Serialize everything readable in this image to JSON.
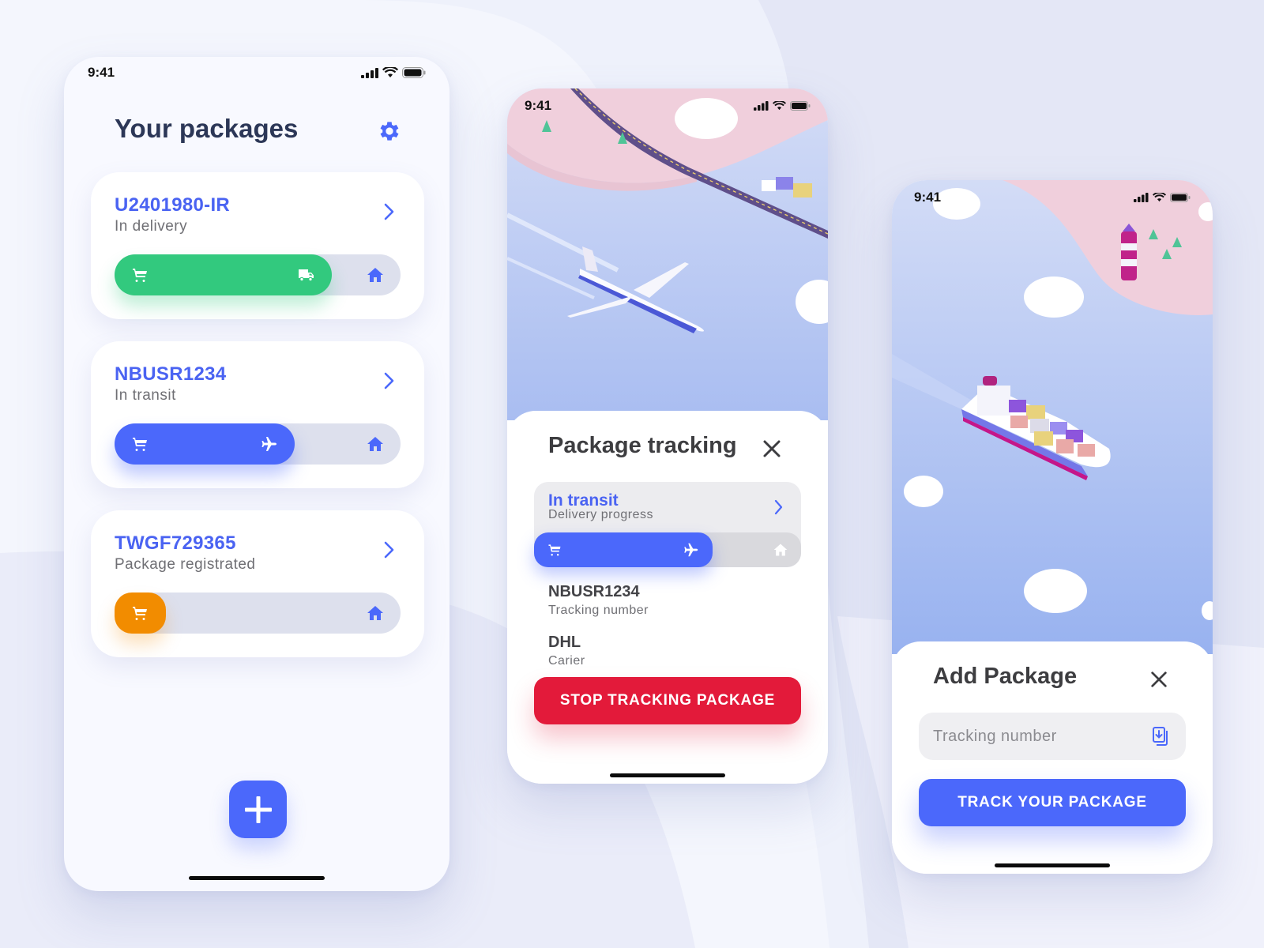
{
  "colors": {
    "accent": "#4b68fb",
    "green": "#32c97e",
    "orange": "#f28c00",
    "red": "#e31a3a",
    "title": "#2c3757"
  },
  "status_bar": {
    "time": "9:41",
    "icons": [
      "cellular-signal-icon",
      "wifi-icon",
      "battery-icon"
    ]
  },
  "packages_screen": {
    "title": "Your packages",
    "settings_icon": "gear-icon",
    "packages": [
      {
        "id": "U2401980-IR",
        "status": "In delivery",
        "progress": 0.76,
        "stage_icon": "truck-icon",
        "color": "green"
      },
      {
        "id": "NBUSR1234",
        "status": "In transit",
        "progress": 0.63,
        "stage_icon": "airplane-icon",
        "color": "accent"
      },
      {
        "id": "TWGF729365",
        "status": "Package registrated",
        "progress": 0.18,
        "stage_icon": "cart-icon",
        "color": "orange"
      }
    ],
    "add_button_icon": "plus-icon"
  },
  "tracking_screen": {
    "title": "Package tracking",
    "status": "In transit",
    "status_sub": "Delivery progress",
    "progress": 0.67,
    "tracking_number": "NBUSR1234",
    "tracking_number_label": "Tracking number",
    "carrier": "DHL",
    "carrier_label": "Carier",
    "stop_button": "STOP TRACKING PACKAGE"
  },
  "add_screen": {
    "title": "Add Package",
    "input_placeholder": "Tracking number",
    "input_value": "",
    "track_button": "TRACK YOUR PACKAGE"
  }
}
